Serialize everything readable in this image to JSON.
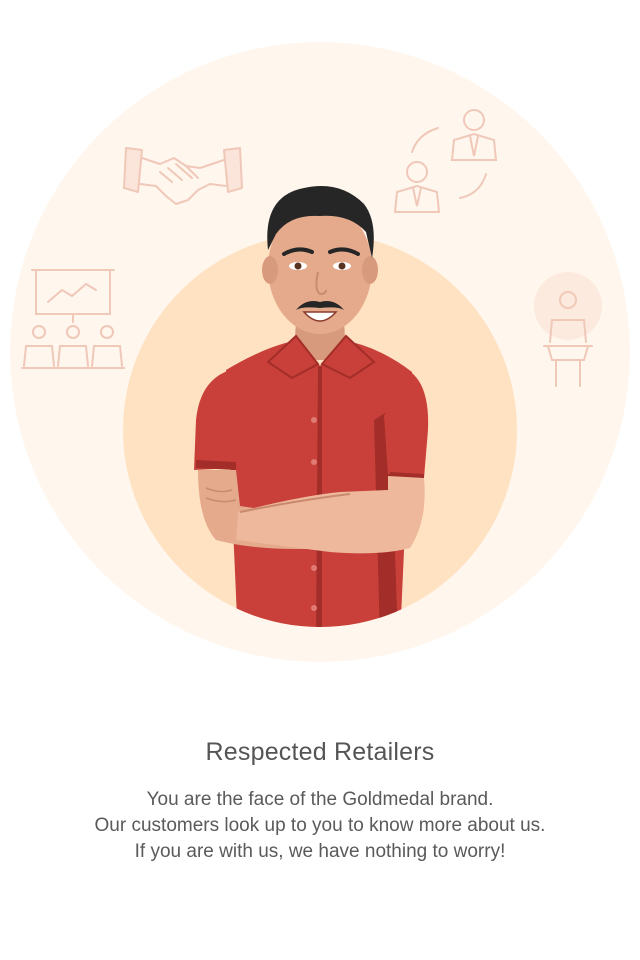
{
  "onboarding": {
    "title": "Respected Retailers",
    "description_lines": [
      "You are the face of the Goldmedal brand.",
      "Our customers look up to you to know more about us.",
      "If you are with us, we have nothing to worry!"
    ]
  },
  "illustration": {
    "icons": [
      "handshake-icon",
      "team-exchange-icon",
      "presentation-icon",
      "desk-person-icon"
    ],
    "colors": {
      "outer_circle": "#FFF6EE",
      "inner_circle": "#FFE2C2",
      "line_icon": "#F3CFC0",
      "shirt": "#C9403A",
      "shirt_shadow": "#A32D28",
      "skin": "#E5AA8C",
      "hair": "#262626"
    }
  }
}
